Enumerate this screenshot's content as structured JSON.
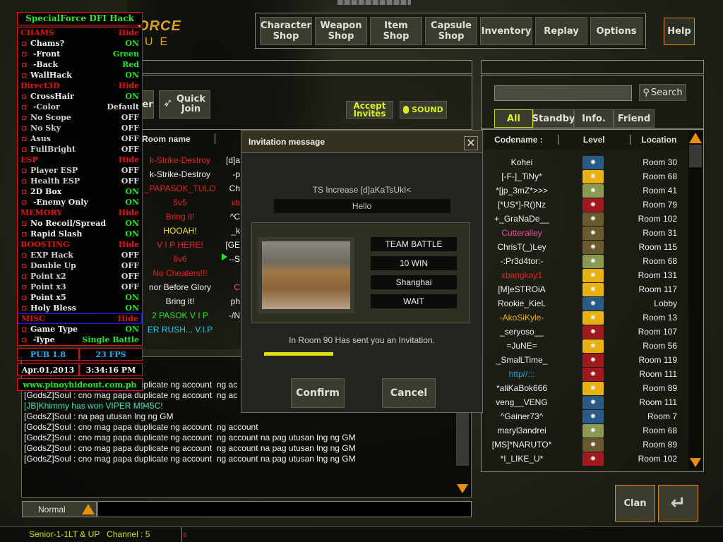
{
  "hack": {
    "title": "SpecialForce DFI Hack",
    "rows": [
      {
        "label": "CHAMS",
        "value": "Hide",
        "type": "section"
      },
      {
        "label": "Chams?",
        "value": "ON",
        "type": "on",
        "lc": "white"
      },
      {
        "label": " -Front",
        "value": "Green",
        "type": "on",
        "lc": "white"
      },
      {
        "label": " -Back",
        "value": "Red",
        "type": "on",
        "lc": "white"
      },
      {
        "label": "WallHack",
        "value": "ON",
        "type": "on",
        "lc": "white"
      },
      {
        "label": "Direct3D",
        "value": "Hide",
        "type": "section"
      },
      {
        "label": "CrossHair",
        "value": "ON",
        "type": "on",
        "lc": "white"
      },
      {
        "label": " -Color",
        "value": "Default",
        "type": "off",
        "lc": "grey"
      },
      {
        "label": "No Scope",
        "value": "OFF",
        "type": "off",
        "lc": "grey"
      },
      {
        "label": "No Sky",
        "value": "OFF",
        "type": "off",
        "lc": "grey"
      },
      {
        "label": "Asus",
        "value": "OFF",
        "type": "off",
        "lc": "grey"
      },
      {
        "label": "FullBright",
        "value": "OFF",
        "type": "off",
        "lc": "grey"
      },
      {
        "label": "ESP",
        "value": "Hide",
        "type": "section"
      },
      {
        "label": "Player ESP",
        "value": "OFF",
        "type": "off",
        "lc": "grey"
      },
      {
        "label": "Health ESP",
        "value": "OFF",
        "type": "off",
        "lc": "grey"
      },
      {
        "label": "2D Box",
        "value": "ON",
        "type": "on",
        "lc": "white"
      },
      {
        "label": " -Enemy Only",
        "value": "ON",
        "type": "on",
        "lc": "white"
      },
      {
        "label": "MEMORY",
        "value": "Hide",
        "type": "section"
      },
      {
        "label": "No Recoil/Spread",
        "value": "ON",
        "type": "on",
        "lc": "white"
      },
      {
        "label": "Rapid Slash",
        "value": "ON",
        "type": "on",
        "lc": "white"
      },
      {
        "label": "BOOSTING",
        "value": "Hide",
        "type": "section"
      },
      {
        "label": "EXP Hack",
        "value": "OFF",
        "type": "off",
        "lc": "grey"
      },
      {
        "label": "Double Up",
        "value": "OFF",
        "type": "off",
        "lc": "grey"
      },
      {
        "label": "Point x2",
        "value": "OFF",
        "type": "off",
        "lc": "grey"
      },
      {
        "label": "Point x3",
        "value": "OFF",
        "type": "off",
        "lc": "grey"
      },
      {
        "label": "Point x5",
        "value": "ON",
        "type": "on",
        "lc": "white"
      },
      {
        "label": "Holy Bless",
        "value": "ON",
        "type": "on",
        "lc": "white"
      },
      {
        "label": "MISC",
        "value": "Hide",
        "type": "section",
        "highlight": true
      },
      {
        "label": "Game Type",
        "value": "ON",
        "type": "on",
        "lc": "white"
      },
      {
        "label": " -Type",
        "value": "Single Battle",
        "type": "on",
        "lc": "white"
      }
    ],
    "version": "PUB 1.8",
    "fps": "23 FPS",
    "date": "Apr.01,2013",
    "time": "3:34:16 PM",
    "website": "www.pinoyhideout.com.ph"
  },
  "logo": {
    "line1": "ORCE",
    "line2": "UE"
  },
  "nav": {
    "buttons": [
      "Character\nShop",
      "Weapon\nShop",
      "Item\nShop",
      "Capsule\nShop",
      "Inventory",
      "Replay",
      "Options"
    ],
    "help": "Help"
  },
  "lobby": {
    "partial_button": "er",
    "quick_join": "Quick\nJoin",
    "accept_invites": "Accept\nInvites",
    "sound": "SOUND",
    "room_header": "Room name",
    "rooms": [
      {
        "name": "k-Strike-Destroy",
        "color": "#e82020",
        "host": "[d]a",
        "hcolor": "#f0f0f0"
      },
      {
        "name": "k-Strike-Destroy",
        "color": "#f0f0f0",
        "host": "-p",
        "hcolor": "#f0f0f0"
      },
      {
        "name": "_PAPASOK_TULO",
        "color": "#e82020",
        "host": "Ch",
        "hcolor": "#f0f0f0"
      },
      {
        "name": "5v5",
        "color": "#e82020",
        "host": "xb",
        "hcolor": "#e82020"
      },
      {
        "name": "Bring it!",
        "color": "#e82020",
        "host": "^C",
        "hcolor": "#f0f0f0"
      },
      {
        "name": "HOOAH!",
        "color": "#f0e020",
        "host": "_k",
        "hcolor": "#f0f0f0"
      },
      {
        "name": "V I P HERE!",
        "color": "#e82020",
        "host": "[GE",
        "hcolor": "#f0f0f0"
      },
      {
        "name": "6v6",
        "color": "#e82020",
        "host": "--S",
        "hcolor": "#f0f0f0"
      },
      {
        "name": "No Cheaters!!!",
        "color": "#e82020",
        "host": "",
        "hcolor": "#f0f0f0"
      },
      {
        "name": "nor Before Glory",
        "color": "#f0f0f0",
        "host": "C",
        "hcolor": "#e050a0"
      },
      {
        "name": "Bring it!",
        "color": "#f0f0f0",
        "host": "ph",
        "hcolor": "#f0f0f0"
      },
      {
        "name": "2 PASOK V I P",
        "color": "#22e822",
        "host": "-/N",
        "hcolor": "#f0f0f0"
      },
      {
        "name": "ER RUSH... V.I.P",
        "color": "#20d0e8",
        "host": "",
        "hcolor": "#f0f0f0"
      }
    ]
  },
  "dialog": {
    "title": "Invitation message",
    "sender": "TS Increase [d]aKaTsUkI<",
    "message": "Hello",
    "mode": "TEAM BATTLE",
    "goal": "10 WIN",
    "map": "Shanghai",
    "status": "WAIT",
    "invite_text": "In Room 90 Has sent you an Invitation.",
    "timer_progress": 0.35,
    "confirm": "Confirm",
    "cancel": "Cancel"
  },
  "players": {
    "search_placeholder": "",
    "search_label": "Search",
    "tabs": [
      "All",
      "Standby",
      "Info.",
      "Friend"
    ],
    "active_tab": "All",
    "headers": {
      "codename": "Codename :",
      "level": "Level",
      "location": "Location"
    },
    "list": [
      {
        "name": "Kohei",
        "color": "#f0f0f0",
        "badge": "#2a5a86",
        "location": "Room 30"
      },
      {
        "name": "[-F-]_TiNy*",
        "color": "#f0f0f0",
        "badge": "#e8b010",
        "location": "Room 68"
      },
      {
        "name": "*[jp_3mZ*>>>",
        "color": "#f0f0f0",
        "badge": "#8a9a50",
        "location": "Room 41"
      },
      {
        "name": "[*US*]-R()Nz",
        "color": "#f0f0f0",
        "badge": "#a01820",
        "location": "Room 79"
      },
      {
        "name": "+_GraNaDe__",
        "color": "#f0f0f0",
        "badge": "#6a5a30",
        "location": "Room 102"
      },
      {
        "name": "Cutteralley",
        "color": "#e050a0",
        "badge": "#6a5a30",
        "location": "Room 31"
      },
      {
        "name": "ChrisT(_)Ley",
        "color": "#f0f0f0",
        "badge": "#6a5a30",
        "location": "Room 115"
      },
      {
        "name": "-:Pr3d4tor:-",
        "color": "#f0f0f0",
        "badge": "#8a9a50",
        "location": "Room 68"
      },
      {
        "name": "xbangkay1",
        "color": "#e82020",
        "badge": "#e8b010",
        "location": "Room 131"
      },
      {
        "name": "[M]eSTROiA",
        "color": "#f0f0f0",
        "badge": "#e8b010",
        "location": "Room 117"
      },
      {
        "name": "Rookie_KieL",
        "color": "#f0f0f0",
        "badge": "#2a5a86",
        "location": "Lobby"
      },
      {
        "name": "-AkoSiKyle-",
        "color": "#e8b010",
        "badge": "#e8b010",
        "location": "Room 13"
      },
      {
        "name": "_seryoso__",
        "color": "#f0f0f0",
        "badge": "#a01820",
        "location": "Room 107"
      },
      {
        "name": "=JuNE=",
        "color": "#f0f0f0",
        "badge": "#e8b010",
        "location": "Room 56"
      },
      {
        "name": "_SmalLTime_",
        "color": "#f0f0f0",
        "badge": "#a01820",
        "location": "Room 119"
      },
      {
        "name": "http//:::",
        "color": "#20a0e8",
        "badge": "#a01820",
        "location": "Room 111"
      },
      {
        "name": "*aliKaBok666",
        "color": "#f0f0f0",
        "badge": "#e8b010",
        "location": "Room 89"
      },
      {
        "name": "veng__VENG",
        "color": "#f0f0f0",
        "badge": "#2a5a86",
        "location": "Room 111"
      },
      {
        "name": "^Gainer73^",
        "color": "#f0f0f0",
        "badge": "#2a5a86",
        "location": "Room 7"
      },
      {
        "name": "maryl3andrei",
        "color": "#f0f0f0",
        "badge": "#8a9a50",
        "location": "Room 68"
      },
      {
        "name": "[MS]*NARUTO*",
        "color": "#f0f0f0",
        "badge": "#6a5a30",
        "location": "Room 89"
      },
      {
        "name": "*I_LIKE_U*",
        "color": "#f0f0f0",
        "badge": "#a01820",
        "location": "Room 102"
      }
    ]
  },
  "chat": {
    "messages": [
      {
        "text": "[GodsZ]Soul : cno mag papa duplicate ng account  ng ac",
        "color": "#f0f0f0"
      },
      {
        "text": "[GodsZ]Soul : cno mag papa duplicate ng account  ng ac",
        "color": "#f0f0f0"
      },
      {
        "text": "[JB]Khimmy has won VIPER M945C!",
        "color": "#40e0c0"
      },
      {
        "text": "[GodsZ]Soul : na pag utusan lng ng GM",
        "color": "#f0f0f0"
      },
      {
        "text": "[GodsZ]Soul : cno mag papa duplicate ng account  ng account",
        "color": "#f0f0f0"
      },
      {
        "text": "[GodsZ]Soul : cno mag papa duplicate ng account  ng account na pag utusan lng ng GM",
        "color": "#f0f0f0"
      },
      {
        "text": "[GodsZ]Soul : cno mag papa duplicate ng account  ng account na pag utusan lng ng GM",
        "color": "#f0f0f0"
      },
      {
        "text": "[GodsZ]Soul : cno mag papa duplicate ng account  ng account na pag utusan lng ng GM",
        "color": "#f0f0f0"
      }
    ],
    "mode": "Normal",
    "input_value": ""
  },
  "status_bar": {
    "channel": "Senior-1-1LT & UP   Channel : 5",
    "extra": "s"
  },
  "bottom": {
    "clan": "Clan"
  }
}
